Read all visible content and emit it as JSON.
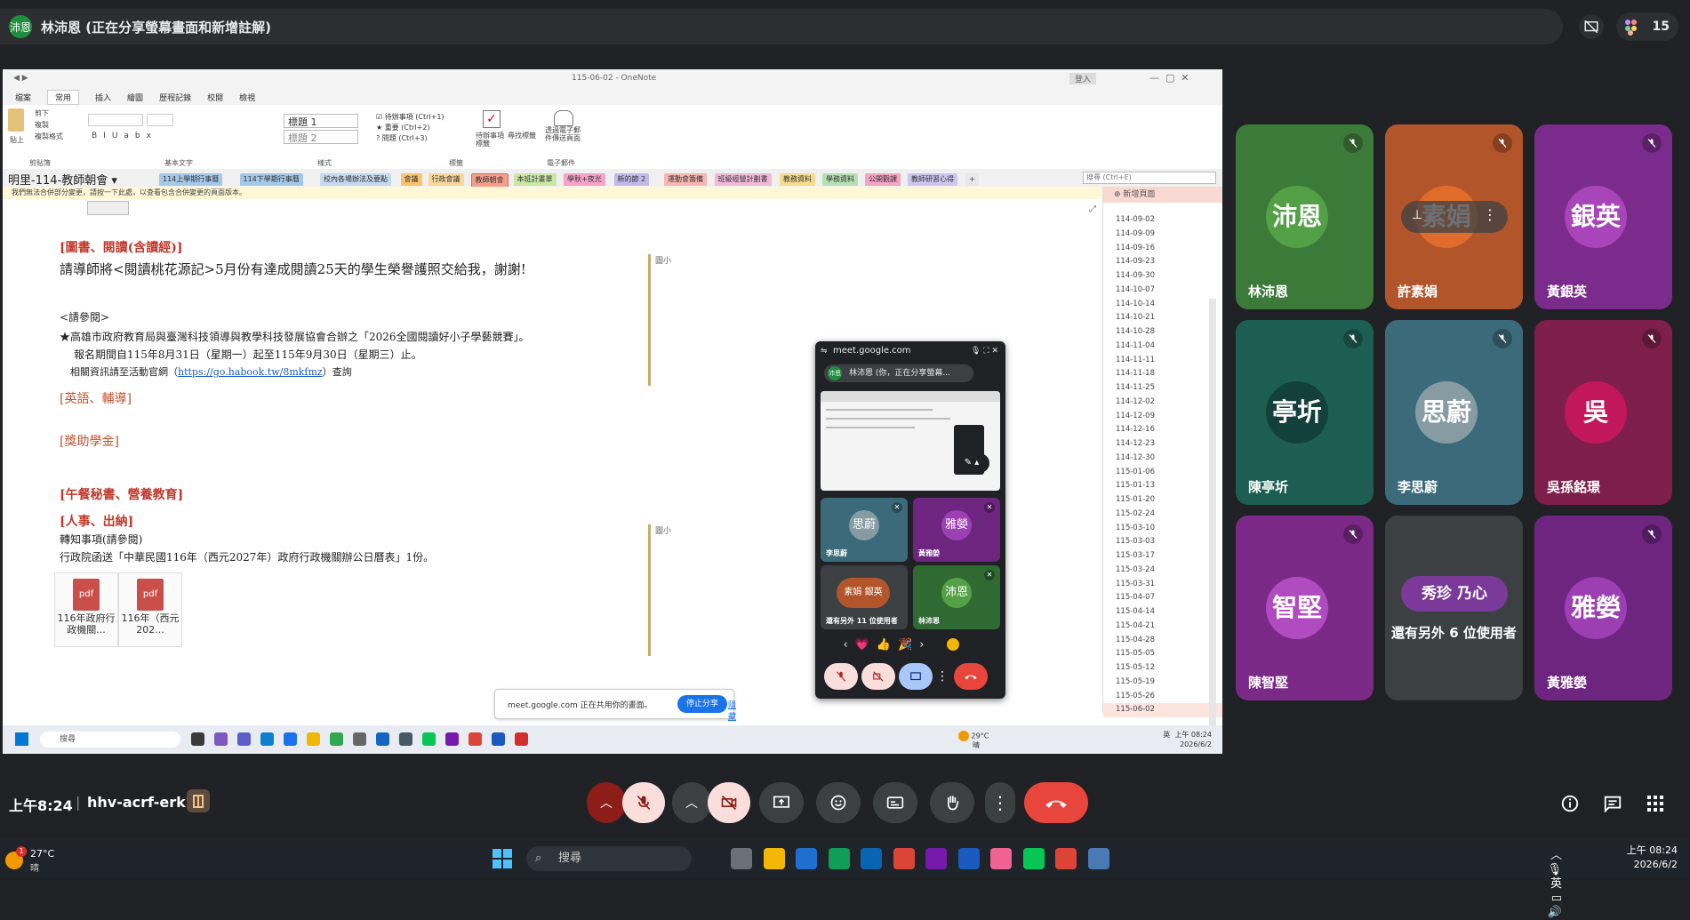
{
  "meet": {
    "presenter_avatar": "沛恩",
    "presenter_title": "林沛恩 (正在分享螢幕畫面和新增註解)",
    "participant_count": "15",
    "clock": "上午8:24",
    "separator": "|",
    "meeting_code": "hhv-acrf-erk",
    "tiles": [
      {
        "initials": "沛恩",
        "name": "林沛恩",
        "color": "#3c7a3a",
        "circle": "#53a046"
      },
      {
        "initials": "素娟",
        "name": "許素娟",
        "color": "#b3552a",
        "circle": "#e06c2c"
      },
      {
        "initials": "銀英",
        "name": "黃銀英",
        "color": "#7b2b8c",
        "circle": "#a845b8"
      },
      {
        "initials": "亭圻",
        "name": "陳亭圻",
        "color": "#1c5f52",
        "circle": "#13403a"
      },
      {
        "initials": "思蔚",
        "name": "李思蔚",
        "color": "#3b6a7a",
        "circle": "#879ba3"
      },
      {
        "initials": "吳",
        "name": "吳孫銘璟",
        "color": "#7d1f4a",
        "circle": "#c2185b"
      },
      {
        "initials": "智堅",
        "name": "陳智堅",
        "color": "#7a2a86",
        "circle": "#b04bc0"
      },
      {
        "initials": "秀珍 乃心",
        "name": "還有另外 6 位使用者",
        "color": "#3c4043",
        "circle": "#7b3a9a"
      },
      {
        "initials": "雅嫈",
        "name": "黃雅嫈",
        "color": "#6d2580",
        "circle": "#9c3fb2"
      }
    ],
    "tile_overlay_icon": "more-vertical-icon"
  },
  "onenote": {
    "window_title": "115-06-02 - OneNote",
    "signin": "登入",
    "ribbon_tabs": [
      "檔案",
      "常用",
      "插入",
      "繪圖",
      "歷程記錄",
      "校閱",
      "檢視"
    ],
    "active_tab": "常用",
    "clipboard": {
      "cut": "剪下",
      "copy": "複製",
      "format": "複製格式",
      "paste": "貼上",
      "group": "剪貼簿"
    },
    "basic_text_group": "基本文字",
    "styles": {
      "h1": "標題 1",
      "h2": "標題 2",
      "group": "樣式"
    },
    "tags": {
      "todo": "待辦事項 (Ctrl+1)",
      "important": "重要 (Ctrl+2)",
      "question": "問題 (Ctrl+3)",
      "group": "標籤",
      "todo_tag": "待辦事項標籤",
      "find_tags": "尋找標籤"
    },
    "email": {
      "label": "透過電子郵件傳送頁面",
      "group": "電子郵件"
    },
    "notebook": "明里-114-教師朝會",
    "sections": [
      {
        "label": "114上學期行事曆",
        "color": "#a6c8e8"
      },
      {
        "label": "114下學期行事曆",
        "color": "#a6c8e8"
      },
      {
        "label": "校內各場辦法及要點",
        "color": "#c6d9ef"
      },
      {
        "label": "會議",
        "color": "#f7c46c"
      },
      {
        "label": "行政會議",
        "color": "#f7d79b"
      },
      {
        "label": "教師朝會",
        "color": "#f59e8b"
      },
      {
        "label": "本班計畫單",
        "color": "#c9e7a6"
      },
      {
        "label": "學秋+夜光",
        "color": "#f5a3c7"
      },
      {
        "label": "新的節 2",
        "color": "#c3b8ea"
      },
      {
        "label": "運動會籌備",
        "color": "#f7b6b0"
      },
      {
        "label": "班級經營計劃書",
        "color": "#f0b9d8"
      },
      {
        "label": "教務資料",
        "color": "#f3dd8c"
      },
      {
        "label": "學務資料",
        "color": "#b6e0b4"
      },
      {
        "label": "公開觀課",
        "color": "#f5a4c1"
      },
      {
        "label": "教師研習心得",
        "color": "#cfc6f0"
      },
      {
        "label": "+",
        "color": "#e8e8e8"
      }
    ],
    "search_placeholder": "搜尋 (Ctrl+E)",
    "warning": "我們無法合併部分變更，請按一下此處，以查看包含合併變更的頁面版本。",
    "add_page": "新增頁面",
    "page": {
      "h_library": "[圖書、閱讀(含讀經)]",
      "line1": "請導師將<閱讀桃花源記>5月份有達成閱讀25天的學生榮譽護照交給我，謝謝!",
      "ref_label": "<請參閱>",
      "line2": "★高雄市政府教育局與臺灣科技領導與教學科技發展協會合辦之「2026全國閱讀好小子學藝競賽」。",
      "line3": "報名期間自115年8月31日（星期一）起至115年9月30日（星期三）止。",
      "line4_prefix": "相關資訊請至活動官網（",
      "line4_link": "https://go.habook.tw/8mkfmz",
      "line4_suffix": "）查詢",
      "h_english": "[英語、輔導]",
      "h_scholar": "[獎助學金]",
      "h_lunch": "[午餐秘書、營養教育]",
      "h_hr": "[人事、出納]",
      "line5": "轉知事項(請參閱)",
      "line6": "行政院函送「中華民國116年（西元2027年）政府行政機關辦公日曆表」1份。",
      "side_label": "圖小",
      "pdf1": "116年政府行政機關...",
      "pdf2": "116年（西元202...",
      "pdf_tag": "pdf"
    },
    "pages": [
      "114-09-02",
      "114-09-09",
      "114-09-16",
      "114-09-23",
      "114-09-30",
      "114-10-07",
      "114-10-14",
      "114-10-21",
      "114-10-28",
      "114-11-04",
      "114-11-11",
      "114-11-18",
      "114-11-25",
      "114-12-02",
      "114-12-09",
      "114-12-16",
      "114-12-23",
      "114-12-30",
      "115-01-06",
      "115-01-13",
      "115-01-20",
      "115-02-24",
      "115-03-10",
      "115-03-03",
      "115-03-17",
      "115-03-24",
      "115-03-31",
      "115-04-07",
      "115-04-14",
      "115-04-21",
      "115-04-28",
      "115-05-05",
      "115-05-12",
      "115-05-19",
      "115-05-26",
      "115-06-02"
    ],
    "selected_page": "115-06-02",
    "share_notice": {
      "text": "meet.google.com 正在共用你的畫面。",
      "stop": "停止分享",
      "hide": "隱藏"
    },
    "inner_taskbar": {
      "search": "搜尋",
      "weather_temp": "29°C",
      "weather_cond": "晴",
      "lang": "英",
      "time": "上午 08:24",
      "date": "2026/6/2"
    }
  },
  "pip": {
    "url": "meet.google.com",
    "presenting": "林沛恩 (你，正在分享螢幕...",
    "avatar": "沛恩",
    "tiles": [
      {
        "initials": "思蔚",
        "name": "李思蔚",
        "color": "#3b6a7a",
        "circle": "#879ba3"
      },
      {
        "initials": "雅嫈",
        "name": "黃雅嫈",
        "color": "#6d2580",
        "circle": "#9c3fb2"
      },
      {
        "initials": "素娟 銀英",
        "name": "還有另外 11 位使用者",
        "color": "#3c4043",
        "circle": "#b3552a"
      },
      {
        "initials": "沛恩",
        "name": "林沛恩",
        "color": "#2f6a33",
        "circle": "#53a046"
      }
    ],
    "reactions": [
      "‹",
      "💗",
      "👍",
      "🎉",
      "›"
    ]
  },
  "taskbar": {
    "weather_temp": "27°C",
    "weather_cond": "晴",
    "badge": "1",
    "search": "搜尋",
    "lang": "英",
    "time": "上午 08:24",
    "date": "2026/6/2"
  },
  "colors": {
    "hangup": "#e8453c",
    "muted": "#f9dedc",
    "accent": "#1a73e8"
  }
}
